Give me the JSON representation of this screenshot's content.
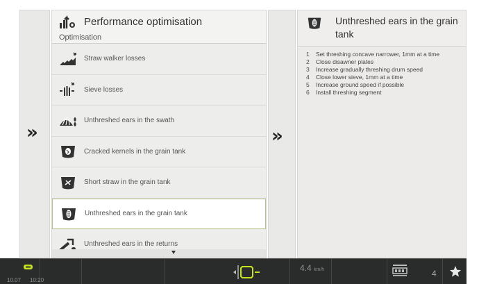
{
  "menu": {
    "title": "Performance optimisation",
    "subtitle": "Optimisation",
    "title_icon": "performance-optimisation-icon",
    "items": [
      {
        "label": "Straw walker losses",
        "icon": "straw-walker-losses-icon"
      },
      {
        "label": "Sieve losses",
        "icon": "sieve-losses-icon"
      },
      {
        "label": "Unthreshed ears in the swath",
        "icon": "unthreshed-ears-swath-icon"
      },
      {
        "label": "Cracked kernels in the grain tank",
        "icon": "cracked-kernels-icon"
      },
      {
        "label": "Short straw in the grain tank",
        "icon": "short-straw-icon"
      },
      {
        "label": "Unthreshed ears in the grain tank",
        "icon": "unthreshed-ears-grain-tank-icon",
        "selected": true
      },
      {
        "label": "Unthreshed ears in the returns",
        "icon": "unthreshed-ears-returns-icon"
      }
    ]
  },
  "detail": {
    "title": "Unthreshed ears in the grain tank",
    "icon": "unthreshed-ears-grain-tank-icon",
    "steps": [
      {
        "num": "1",
        "text": "Set threshing concave narrower, 1mm at a time"
      },
      {
        "num": "2",
        "text": "Close disawner plates"
      },
      {
        "num": "3",
        "text": "Increase gradually threshing drum speed"
      },
      {
        "num": "4",
        "text": "Close lower sieve, 1mm at a time"
      },
      {
        "num": "5",
        "text": "Increase ground speed if possible"
      },
      {
        "num": "6",
        "text": "Install threshing segment"
      }
    ]
  },
  "nav": {
    "left_arrow": "»",
    "mid_arrow": "»"
  },
  "status_bar": {
    "date": "10.07",
    "time": "10:20",
    "speed_value": "4.4",
    "speed_unit": "km/h",
    "gear": "4",
    "icons": [
      "battery-icon",
      "header-position-icon",
      "transmission-icon",
      "favourite-star-icon"
    ]
  },
  "colors": {
    "accent_green": "#c8e21a",
    "selected_border": "#b8c48c",
    "bar_background": "#2a2b2b"
  }
}
